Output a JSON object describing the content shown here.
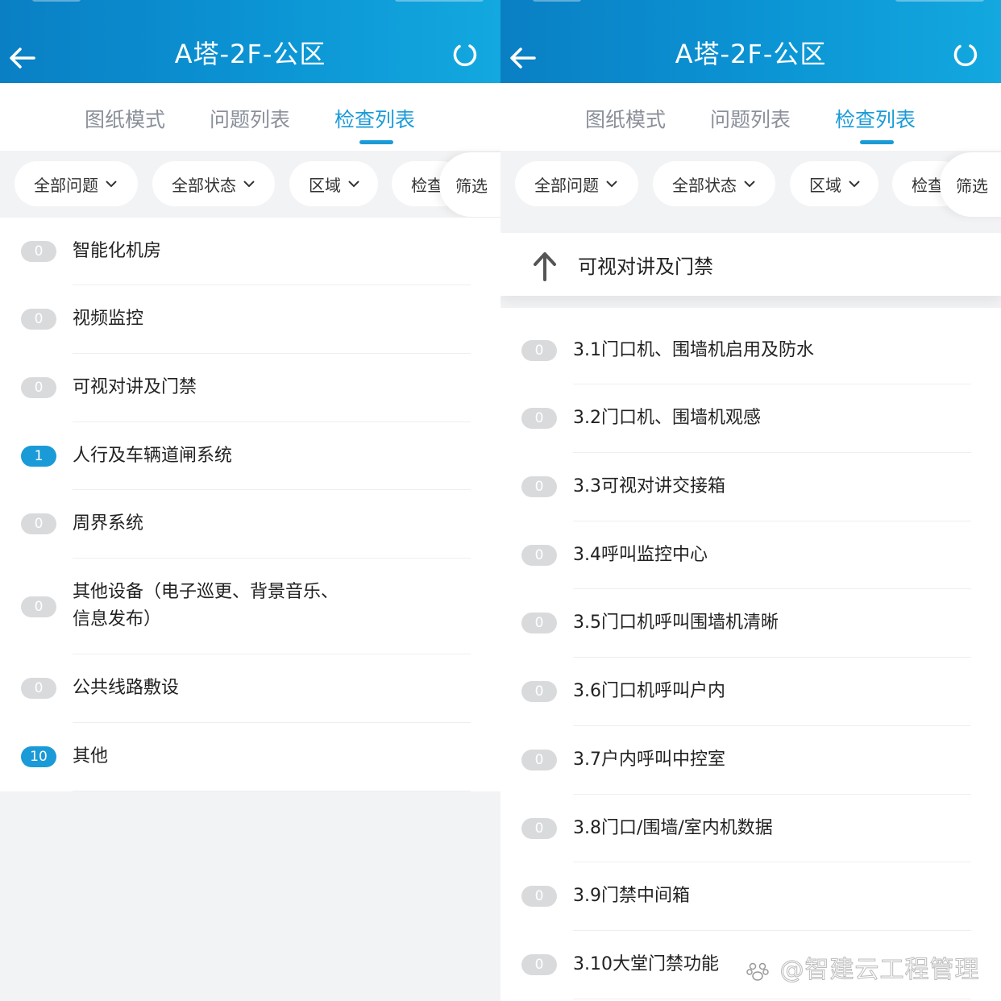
{
  "left": {
    "header": {
      "title": "A塔-2F-公区",
      "back_icon": "arrow-left-icon",
      "refresh_icon": "refresh-icon"
    },
    "tabs": [
      {
        "label": "图纸模式",
        "active": false
      },
      {
        "label": "问题列表",
        "active": false
      },
      {
        "label": "检查列表",
        "active": true
      }
    ],
    "filters": {
      "issue": "全部问题",
      "status": "全部状态",
      "area": "区域",
      "check_cut": "检查",
      "filter": "筛选"
    },
    "items": [
      {
        "count": "0",
        "label": "智能化机房",
        "highlight": false
      },
      {
        "count": "0",
        "label": "视频监控",
        "highlight": false
      },
      {
        "count": "0",
        "label": "可视对讲及门禁",
        "highlight": false
      },
      {
        "count": "1",
        "label": "人行及车辆道闸系统",
        "highlight": true
      },
      {
        "count": "0",
        "label": "周界系统",
        "highlight": false
      },
      {
        "count": "0",
        "label_line1": "其他设备（电子巡更、背景音乐、",
        "label_line2": "信息发布）",
        "highlight": false
      },
      {
        "count": "0",
        "label": "公共线路敷设",
        "highlight": false
      },
      {
        "count": "10",
        "label": "其他",
        "highlight": true
      }
    ]
  },
  "right": {
    "header": {
      "title": "A塔-2F-公区",
      "back_icon": "arrow-left-icon",
      "refresh_icon": "refresh-icon"
    },
    "tabs": [
      {
        "label": "图纸模式",
        "active": false
      },
      {
        "label": "问题列表",
        "active": false
      },
      {
        "label": "检查列表",
        "active": true
      }
    ],
    "filters": {
      "issue": "全部问题",
      "status": "全部状态",
      "area": "区域",
      "check_cut": "检查",
      "filter": "筛选"
    },
    "parent": {
      "label": "可视对讲及门禁",
      "icon": "arrow-up-icon"
    },
    "items": [
      {
        "count": "0",
        "label": "3.1门口机、围墙机启用及防水"
      },
      {
        "count": "0",
        "label": "3.2门口机、围墙机观感"
      },
      {
        "count": "0",
        "label": "3.3可视对讲交接箱"
      },
      {
        "count": "0",
        "label": "3.4呼叫监控中心"
      },
      {
        "count": "0",
        "label": "3.5门口机呼叫围墙机清晰"
      },
      {
        "count": "0",
        "label": "3.6门口机呼叫户内"
      },
      {
        "count": "0",
        "label": "3.7户内呼叫中控室"
      },
      {
        "count": "0",
        "label": "3.8门口/围墙/室内机数据"
      },
      {
        "count": "0",
        "label": "3.9门禁中间箱"
      },
      {
        "count": "0",
        "label": "3.10大堂门禁功能"
      }
    ]
  },
  "watermark": "@智建云工程管理",
  "colors": {
    "accent": "#1a9bd7",
    "header_start": "#0a7fc4",
    "header_end": "#13a8df",
    "badge_grey": "#d9dadc"
  }
}
